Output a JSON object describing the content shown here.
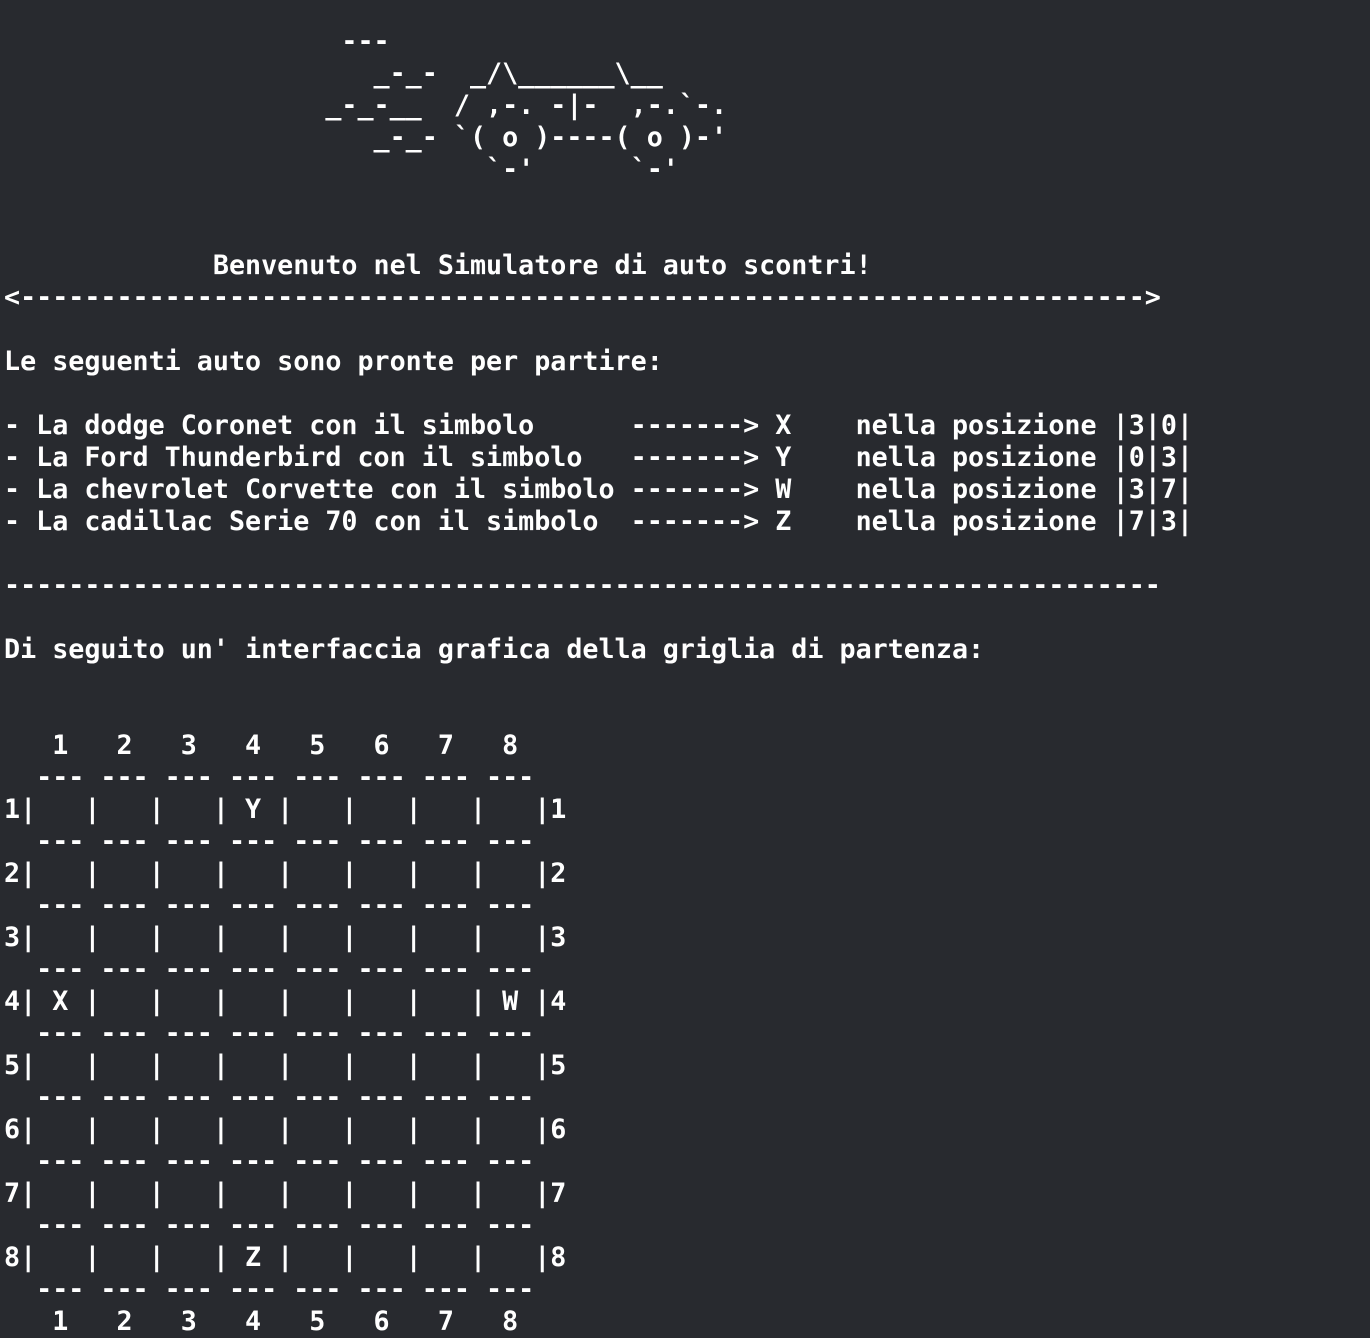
{
  "terminal": {
    "car_art": [
      "                     ---",
      "                       _-_-  _/\\______\\__",
      "                    _-_-__  / ,-. -|-  ,-.`-.",
      "                       _-_- `( o )----( o )-'",
      "                              `-'      `-'"
    ],
    "blank_1": "",
    "blank_2": "",
    "welcome": "             Benvenuto nel Simulatore di auto scontri!",
    "arrow_rule": "<---------------------------------------------------------------------->",
    "blank_3": "",
    "ready_title": "Le seguenti auto sono pronte per partire:",
    "blank_4": "",
    "cars": [
      "- La dodge Coronet con il simbolo      -------> X    nella posizione |3|0|",
      "- La Ford Thunderbird con il simbolo   -------> Y    nella posizione |0|3|",
      "- La chevrolet Corvette con il simbolo -------> W    nella posizione |3|7|",
      "- La cadillac Serie 70 con il simbolo  -------> Z    nella posizione |7|3|"
    ],
    "blank_5": "",
    "dash_rule": "------------------------------------------------------------------------",
    "blank_6": "",
    "grid_title": "Di seguito un' interfaccia grafica della griglia di partenza:",
    "blank_7": "",
    "blank_8": "",
    "grid": {
      "column_header": "   1   2   3   4   5   6   7   8",
      "separator": "  --- --- --- --- --- --- --- ---",
      "rows": [
        "1|   |   |   | Y |   |   |   |   |1",
        "2|   |   |   |   |   |   |   |   |2",
        "3|   |   |   |   |   |   |   |   |3",
        "4| X |   |   |   |   |   |   | W |4",
        "5|   |   |   |   |   |   |   |   |5",
        "6|   |   |   |   |   |   |   |   |6",
        "7|   |   |   |   |   |   |   |   |7",
        "8|   |   |   | Z |   |   |   |   |8"
      ],
      "column_footer": "   1   2   3   4   5   6   7   8"
    }
  }
}
